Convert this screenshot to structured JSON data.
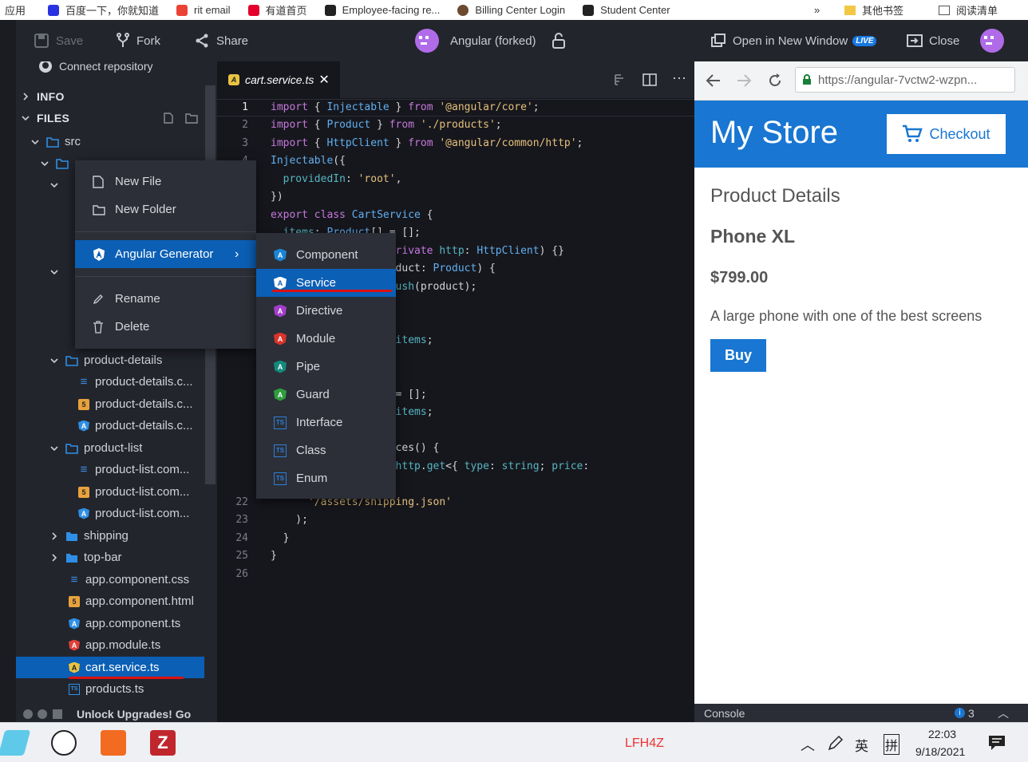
{
  "bookmarks": {
    "items": [
      "应用",
      "百度一下，你就知道",
      "rit email",
      "有道首页",
      "Employee-facing re...",
      "Billing Center Login",
      "Student Center"
    ],
    "more": "»",
    "other": "其他书签",
    "reading": "阅读清单"
  },
  "toolbar": {
    "save": "Save",
    "fork": "Fork",
    "share": "Share",
    "project": "Angular (forked)",
    "open_new_window": "Open in New Window",
    "live": "LIVE",
    "close": "Close"
  },
  "sidebar": {
    "connect": "Connect repository",
    "info": "INFO",
    "files": "FILES",
    "src": "src",
    "tree": [
      {
        "label": "product-details",
        "kind": "folder"
      },
      {
        "label": "product-details.c...",
        "kind": "css"
      },
      {
        "label": "product-details.c...",
        "kind": "html"
      },
      {
        "label": "product-details.c...",
        "kind": "ts"
      },
      {
        "label": "product-list",
        "kind": "folder"
      },
      {
        "label": "product-list.com...",
        "kind": "css"
      },
      {
        "label": "product-list.com...",
        "kind": "html"
      },
      {
        "label": "product-list.com...",
        "kind": "ts"
      },
      {
        "label": "shipping",
        "kind": "folder-closed"
      },
      {
        "label": "top-bar",
        "kind": "folder-closed"
      },
      {
        "label": "app.component.css",
        "kind": "css"
      },
      {
        "label": "app.component.html",
        "kind": "html"
      },
      {
        "label": "app.component.ts",
        "kind": "ts"
      },
      {
        "label": "app.module.ts",
        "kind": "module"
      },
      {
        "label": "cart.service.ts",
        "kind": "service"
      },
      {
        "label": "products.ts",
        "kind": "plain"
      }
    ],
    "footer": "Unlock Upgrades! Go"
  },
  "editor": {
    "tab": "cart.service.ts",
    "lines": [
      {
        "n": "1",
        "t": "import { Injectable } from '@angular/core';"
      },
      {
        "n": "2",
        "t": "import { Product } from './products';"
      },
      {
        "n": "3",
        "t": "import { HttpClient } from '@angular/common/http';"
      },
      {
        "n": "4",
        "t": "@Injectable({"
      },
      {
        "n": "5",
        "t": "  providedIn: 'root',"
      },
      {
        "n": "6",
        "t": "})"
      },
      {
        "n": "7",
        "t": "export class CartService {"
      },
      {
        "n": "",
        "t": "  items: Product[] = [];"
      },
      {
        "n": "",
        "t": "                   private http: HttpClient) {}"
      },
      {
        "n": "",
        "t": "                  roduct: Product) {"
      },
      {
        "n": "",
        "t": "                  .push(product);"
      },
      {
        "n": "",
        "t": ""
      },
      {
        "n": "",
        "t": ""
      },
      {
        "n": "",
        "t": "                  s.items;"
      },
      {
        "n": "",
        "t": ""
      },
      {
        "n": "",
        "t": "                   {"
      },
      {
        "n": "",
        "t": "                    = [];"
      },
      {
        "n": "",
        "t": "                  s.items;"
      },
      {
        "n": "",
        "t": ""
      },
      {
        "n": "",
        "t": "                  rices() {"
      },
      {
        "n": "",
        "t": "                  s.http.get<{ type: string; price:"
      },
      {
        "n": "",
        "t": "                  >("
      },
      {
        "n": "22",
        "t": "      '/assets/shipping.json'"
      },
      {
        "n": "23",
        "t": "    );"
      },
      {
        "n": "24",
        "t": "  }"
      },
      {
        "n": "25",
        "t": "}"
      },
      {
        "n": "26",
        "t": ""
      }
    ]
  },
  "context_menu": {
    "items": [
      "New File",
      "New Folder",
      "Angular Generator",
      "Rename",
      "Delete"
    ]
  },
  "submenu": {
    "items": [
      {
        "label": "Component",
        "color": "#1a85d6",
        "glyph": "A"
      },
      {
        "label": "Service",
        "color": "#1a85d6",
        "glyph": "A"
      },
      {
        "label": "Directive",
        "color": "#a33fc9",
        "glyph": "A"
      },
      {
        "label": "Module",
        "color": "#d9342b",
        "glyph": "A"
      },
      {
        "label": "Pipe",
        "color": "#138a7d",
        "glyph": "A"
      },
      {
        "label": "Guard",
        "color": "#2e9e3e",
        "glyph": "A"
      },
      {
        "label": "Interface",
        "color": "#2f7fd6",
        "glyph": "TS"
      },
      {
        "label": "Class",
        "color": "#2f7fd6",
        "glyph": "TS"
      },
      {
        "label": "Enum",
        "color": "#2f7fd6",
        "glyph": "TS"
      }
    ]
  },
  "preview": {
    "url": "https://angular-7vctw2-wzpn...",
    "store_title": "My Store",
    "checkout": "Checkout",
    "section": "Product Details",
    "product": "Phone XL",
    "price": "$799.00",
    "description": "A large phone with one of the best screens",
    "buy": "Buy",
    "console": "Console",
    "console_count": "3"
  },
  "taskbar": {
    "center": "LFH4Z",
    "ime1": "英",
    "ime2": "拼",
    "time": "22:03",
    "date": "9/18/2021"
  }
}
